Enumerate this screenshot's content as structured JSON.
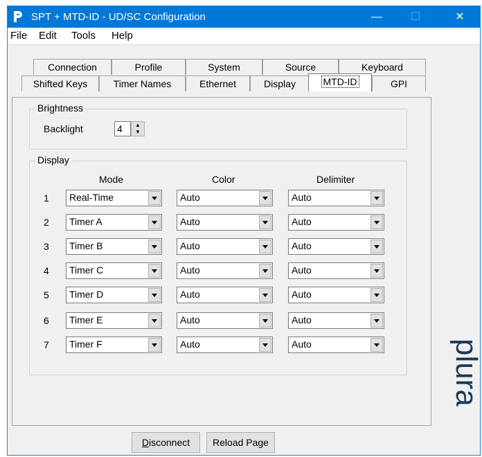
{
  "window": {
    "title": "SPT + MTD-ID - UD/SC Configuration",
    "controls": {
      "minimize": "—",
      "maximize": "☐",
      "close": "✕"
    }
  },
  "menu": [
    "File",
    "Edit",
    "Tools",
    "Help"
  ],
  "tabs": {
    "row_back": [
      "Connection",
      "Profile",
      "System",
      "Source",
      "Keyboard"
    ],
    "row_front": [
      "Shifted Keys",
      "Timer Names",
      "Ethernet",
      "Display",
      "MTD-ID",
      "GPI"
    ],
    "active": "MTD-ID"
  },
  "brightness": {
    "group_label": "Brightness",
    "backlight_label": "Backlight",
    "backlight_value": "4"
  },
  "display": {
    "group_label": "Display",
    "headers": {
      "mode": "Mode",
      "color": "Color",
      "delimiter": "Delimiter"
    },
    "rows": [
      {
        "num": "1",
        "mode": "Real-Time",
        "color": "Auto",
        "delimiter": "Auto"
      },
      {
        "num": "2",
        "mode": "Timer A",
        "color": "Auto",
        "delimiter": "Auto"
      },
      {
        "num": "3",
        "mode": "Timer B",
        "color": "Auto",
        "delimiter": "Auto"
      },
      {
        "num": "4",
        "mode": "Timer C",
        "color": "Auto",
        "delimiter": "Auto"
      },
      {
        "num": "5",
        "mode": "Timer D",
        "color": "Auto",
        "delimiter": "Auto"
      },
      {
        "num": "6",
        "mode": "Timer E",
        "color": "Auto",
        "delimiter": "Auto"
      },
      {
        "num": "7",
        "mode": "Timer F",
        "color": "Auto",
        "delimiter": "Auto"
      }
    ]
  },
  "buttons": {
    "disconnect": "Disconnect",
    "reload": "Reload Page"
  },
  "logo_text": "plura",
  "colors": {
    "titlebar": "#0078d7",
    "logo": "#1b3a57"
  }
}
